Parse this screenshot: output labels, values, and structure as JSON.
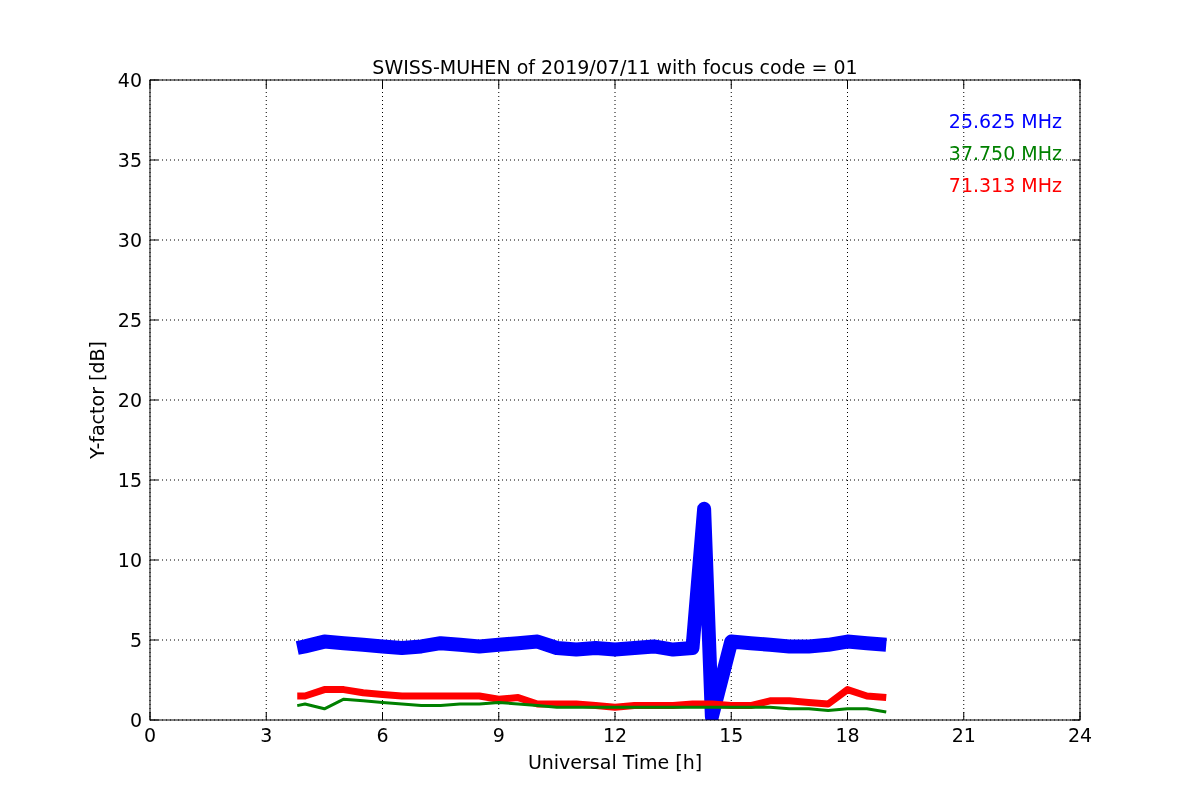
{
  "chart_data": {
    "type": "line",
    "title": "SWISS-MUHEN of 2019/07/11 with focus code = 01",
    "xlabel": "Universal Time [h]",
    "ylabel": "Y-factor [dB]",
    "x": [
      3.8,
      4,
      4.5,
      5,
      5.5,
      6,
      6.5,
      7,
      7.5,
      8,
      8.5,
      9,
      9.5,
      10,
      10.5,
      11,
      11.5,
      12,
      12.5,
      13,
      13.5,
      14,
      14.3,
      14.5,
      15,
      15.5,
      16,
      16.5,
      17,
      17.5,
      18,
      18.5,
      19
    ],
    "series": [
      {
        "name": "25.625 MHz",
        "color": "#0000ff",
        "values": [
          4.5,
          4.6,
          4.9,
          4.8,
          4.7,
          4.6,
          4.5,
          4.6,
          4.8,
          4.7,
          4.6,
          4.7,
          4.8,
          4.9,
          4.5,
          4.4,
          4.5,
          4.4,
          4.5,
          4.6,
          4.4,
          4.5,
          13.2,
          0.2,
          4.9,
          4.8,
          4.7,
          4.6,
          4.6,
          4.7,
          4.9,
          4.8,
          4.7
        ]
      },
      {
        "name": "37.750 MHz",
        "color": "#008000",
        "values": [
          0.9,
          1.0,
          0.7,
          1.3,
          1.2,
          1.1,
          1.0,
          0.9,
          0.9,
          1.0,
          1.0,
          1.1,
          1.0,
          0.9,
          0.8,
          0.8,
          0.8,
          0.8,
          0.8,
          0.8,
          0.8,
          0.8,
          0.8,
          0.8,
          0.8,
          0.8,
          0.8,
          0.7,
          0.7,
          0.6,
          0.7,
          0.7,
          0.5
        ]
      },
      {
        "name": "71.313 MHz",
        "color": "#ff0000",
        "values": [
          1.5,
          1.5,
          1.9,
          1.9,
          1.7,
          1.6,
          1.5,
          1.5,
          1.5,
          1.5,
          1.5,
          1.3,
          1.4,
          1.0,
          1.0,
          1.0,
          0.9,
          0.8,
          0.9,
          0.9,
          0.9,
          1.0,
          1.0,
          1.0,
          0.9,
          0.9,
          1.2,
          1.2,
          1.1,
          1.0,
          1.9,
          1.5,
          1.4
        ]
      }
    ],
    "xlim": [
      0,
      24
    ],
    "ylim": [
      0,
      40
    ],
    "xticks": [
      0,
      3,
      6,
      9,
      12,
      15,
      18,
      21,
      24
    ],
    "yticks": [
      0,
      5,
      10,
      15,
      20,
      25,
      30,
      35,
      40
    ],
    "grid": true
  }
}
